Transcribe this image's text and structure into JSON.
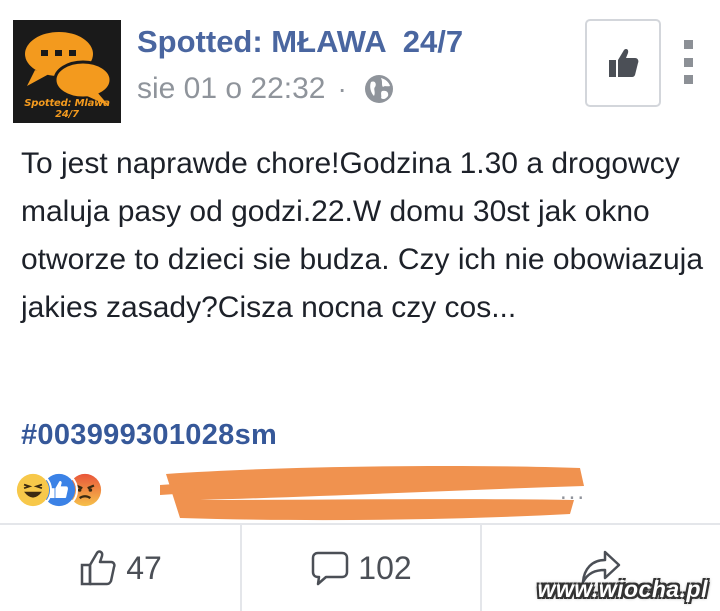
{
  "header": {
    "page_name": "Spotted: MŁAWA  24/7",
    "timestamp": "sie 01 o 22:32",
    "separator": "·",
    "avatar_caption": "Spotted: Mlawa 24/7",
    "privacy_icon": "globe-icon",
    "like_page_icon": "thumbs-up-icon",
    "menu_icon": "more-vertical-icon"
  },
  "post": {
    "text": "To jest naprawde chore!Godzina 1.30 a drogowcy maluja pasy od godzi.22.W domu 30st jak okno otworze to dzieci sie budza. Czy ich nie obowiazuja jakies zasady?Cisza nocna czy cos...",
    "hashtag": "#003999301028sm"
  },
  "reactions": {
    "types": [
      "haha-icon",
      "like-icon",
      "angry-icon"
    ],
    "trailing": "..."
  },
  "actions": {
    "like_count": "47",
    "comment_count": "102"
  },
  "watermark": "www.wiocha.pl",
  "colors": {
    "brand_blue": "#4a66a0",
    "hashtag_blue": "#365899",
    "meta_gray": "#8f949b",
    "redaction_orange": "#f0924f"
  }
}
